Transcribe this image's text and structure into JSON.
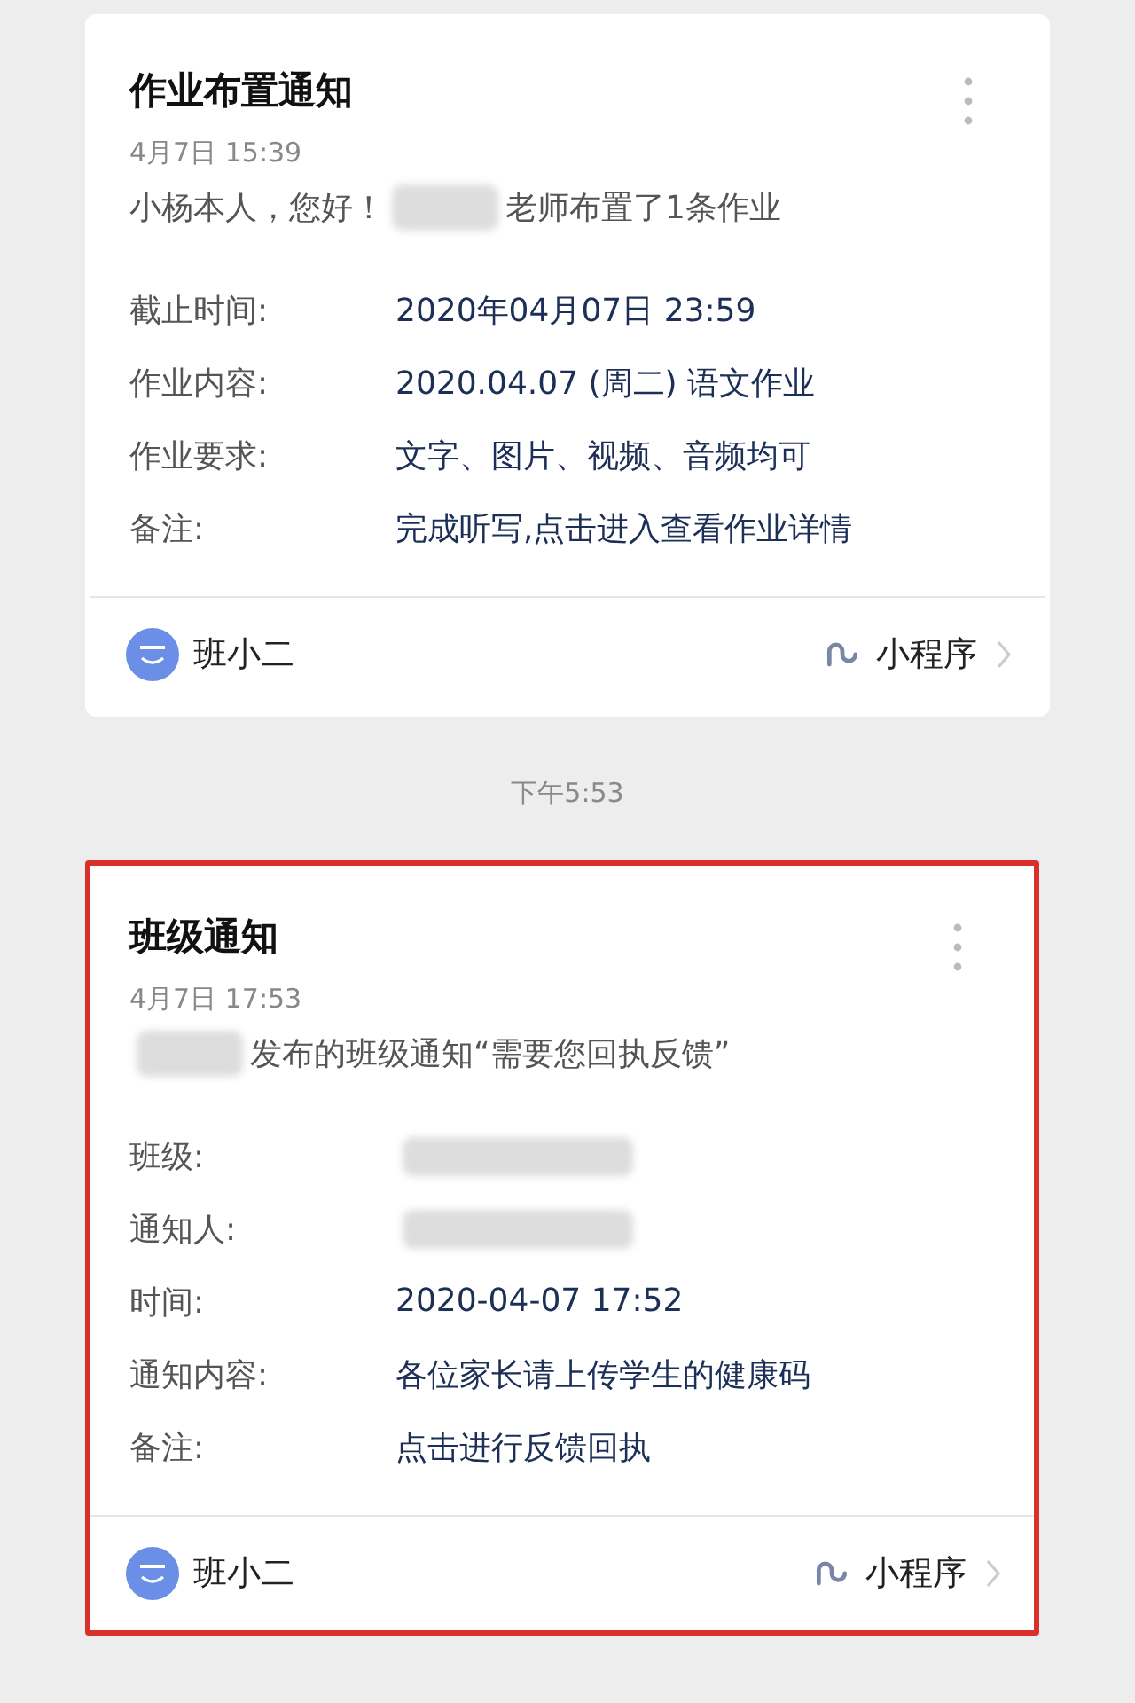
{
  "messages": [
    {
      "kind": "card",
      "highlighted": false,
      "title": "作业布置通知",
      "date": "4月7日  15:39",
      "intro": [
        {
          "kind": "text",
          "text": "小杨本人，您好！"
        },
        {
          "kind": "redacted"
        },
        {
          "kind": "text",
          "text": "老师布置了1条作业"
        }
      ],
      "fields": [
        {
          "label": "截止时间:",
          "kind": "text",
          "value": "2020年04月07日 23:59"
        },
        {
          "label": "作业内容:",
          "kind": "text",
          "value": "2020.04.07 (周二) 语文作业"
        },
        {
          "label": "作业要求:",
          "kind": "text",
          "value": "文字、图片、视频、音频均可"
        },
        {
          "label": "备注:",
          "kind": "text",
          "value": "完成听写,点击进入查看作业详情"
        }
      ],
      "source": "班小二",
      "app_label": "小程序"
    },
    {
      "kind": "time",
      "text": "下午5:53"
    },
    {
      "kind": "card",
      "highlighted": true,
      "title": "班级通知",
      "date": "4月7日  17:53",
      "intro": [
        {
          "kind": "redacted"
        },
        {
          "kind": "text",
          "text": "发布的班级通知“需要您回执反馈”"
        }
      ],
      "fields": [
        {
          "label": "班级:",
          "kind": "redacted"
        },
        {
          "label": "通知人:",
          "kind": "redacted"
        },
        {
          "label": "时间:",
          "kind": "text",
          "value": "2020-04-07 17:52"
        },
        {
          "label": "通知内容:",
          "kind": "text",
          "value": "各位家长请上传学生的健康码"
        },
        {
          "label": "备注:",
          "kind": "text",
          "value": "点击进行反馈回执"
        }
      ],
      "source": "班小二",
      "app_label": "小程序"
    }
  ]
}
